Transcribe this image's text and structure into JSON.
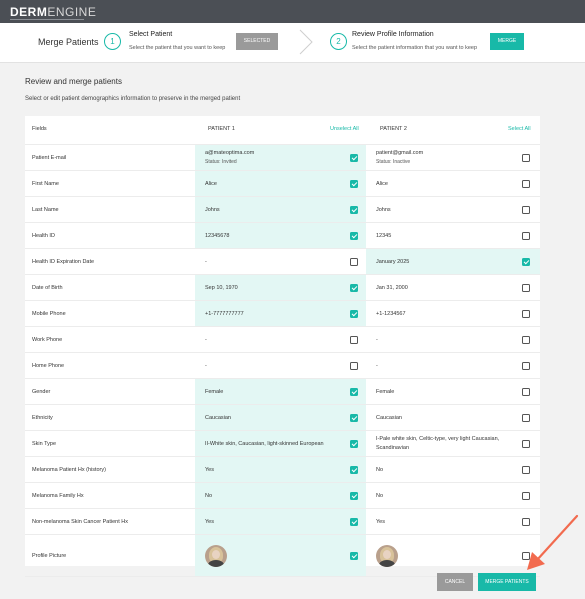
{
  "app": {
    "logo_bold": "DERM",
    "logo_light": "ENGINE"
  },
  "stepper": {
    "title": "Merge Patients",
    "steps": [
      {
        "number": "1",
        "name": "Select Patient",
        "desc": "Select the patient that you want to keep",
        "button": "SELECTED"
      },
      {
        "number": "2",
        "name": "Review Profile Information",
        "desc": "Select the patient information that you want to keep",
        "button": "MERGE"
      }
    ]
  },
  "page": {
    "heading": "Review and merge patients",
    "subheading": "Select or edit patient demographics information to preserve in the merged patient"
  },
  "table": {
    "header": {
      "fields": "Fields",
      "patient1": "PATIENT 1",
      "patient1_action": "Unselect All",
      "patient2": "PATIENT 2",
      "patient2_action": "Select All"
    },
    "rows": [
      {
        "field": "Patient E-mail",
        "p1": "a@mateoptima.com",
        "p1_sub": "Status: Invited",
        "p2": "patient@gmail.com",
        "p2_sub": "Status: Inactive",
        "p1_checked": true,
        "p2_checked": false
      },
      {
        "field": "First Name",
        "p1": "Alice",
        "p2": "Alice",
        "p1_checked": true,
        "p2_checked": false
      },
      {
        "field": "Last Name",
        "p1": "Johns",
        "p2": "Johns",
        "p1_checked": true,
        "p2_checked": false
      },
      {
        "field": "Health ID",
        "p1": "12345678",
        "p2": "12345",
        "p1_checked": true,
        "p2_checked": false
      },
      {
        "field": "Health ID Expiration Date",
        "p1": "-",
        "p2": "January 2025",
        "p1_checked": false,
        "p2_checked": true
      },
      {
        "field": "Date of Birth",
        "p1": "Sep 10, 1970",
        "p2": "Jan 31, 2000",
        "p1_checked": true,
        "p2_checked": false
      },
      {
        "field": "Mobile Phone",
        "p1": "+1-7777777777",
        "p2": "+1-1234567",
        "p1_checked": true,
        "p2_checked": false
      },
      {
        "field": "Work Phone",
        "p1": "-",
        "p2": "-",
        "p1_checked": false,
        "p2_checked": false
      },
      {
        "field": "Home Phone",
        "p1": "-",
        "p2": "-",
        "p1_checked": false,
        "p2_checked": false
      },
      {
        "field": "Gender",
        "p1": "Female",
        "p2": "Female",
        "p1_checked": true,
        "p2_checked": false
      },
      {
        "field": "Ethnicity",
        "p1": "Caucasian",
        "p2": "Caucasian",
        "p1_checked": true,
        "p2_checked": false
      },
      {
        "field": "Skin Type",
        "p1": "II-White skin, Caucasian, light-skinned European",
        "p2": "I-Pale white skin, Celtic-type, very light Caucasian,",
        "p2_line2": "Scandinavian",
        "p1_checked": true,
        "p2_checked": false
      },
      {
        "field": "Melanoma Patient Hx (history)",
        "p1": "Yes",
        "p2": "No",
        "p1_checked": true,
        "p2_checked": false
      },
      {
        "field": "Melanoma Family Hx",
        "p1": "No",
        "p2": "No",
        "p1_checked": true,
        "p2_checked": false
      },
      {
        "field": "Non-melanoma Skin Cancer Patient Hx",
        "p1": "Yes",
        "p2": "Yes",
        "p1_checked": true,
        "p2_checked": false
      },
      {
        "field": "Profile Picture",
        "p1_avatar": "avatar-photo",
        "p2_avatar": "avatar-photo",
        "p1_checked": true,
        "p2_checked": false
      }
    ]
  },
  "footer": {
    "cancel": "CANCEL",
    "merge": "MERGE PATIENTS"
  },
  "colors": {
    "accent": "#18b9a8",
    "selected_bg": "#e3f7f4",
    "topbar": "#4b4f55",
    "annotation_arrow": "#f26b4f"
  }
}
